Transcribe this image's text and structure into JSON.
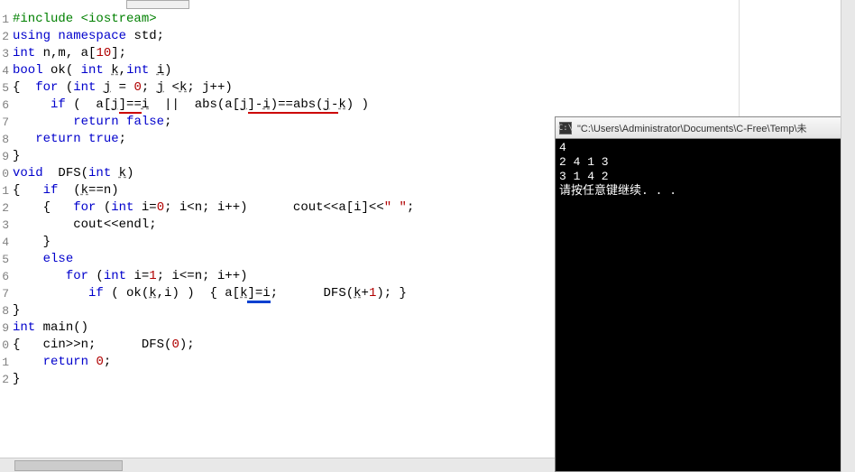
{
  "editor": {
    "lines": [
      {
        "n": "1",
        "tokens": [
          {
            "t": "#include <iostream>",
            "c": "green"
          }
        ]
      },
      {
        "n": "2",
        "tokens": [
          {
            "t": "using",
            "c": "blue"
          },
          {
            "t": " ",
            "c": "black"
          },
          {
            "t": "namespace",
            "c": "blue"
          },
          {
            "t": " std;",
            "c": "black"
          }
        ]
      },
      {
        "n": "3",
        "tokens": [
          {
            "t": "int",
            "c": "blue"
          },
          {
            "t": " n,m, a[",
            "c": "black"
          },
          {
            "t": "10",
            "c": "red"
          },
          {
            "t": "];",
            "c": "black"
          }
        ]
      },
      {
        "n": "4",
        "tokens": [
          {
            "t": "bool",
            "c": "blue"
          },
          {
            "t": " ok( ",
            "c": "black"
          },
          {
            "t": "int",
            "c": "blue"
          },
          {
            "t": " ",
            "c": "black"
          },
          {
            "t": "k",
            "c": "black",
            "d": true
          },
          {
            "t": ",",
            "c": "black"
          },
          {
            "t": "int",
            "c": "blue"
          },
          {
            "t": " ",
            "c": "black"
          },
          {
            "t": "i",
            "c": "black",
            "d": true
          },
          {
            "t": ")",
            "c": "black"
          }
        ]
      },
      {
        "n": "5",
        "tokens": [
          {
            "t": "{  ",
            "c": "black"
          },
          {
            "t": "for",
            "c": "blue"
          },
          {
            "t": " (",
            "c": "black"
          },
          {
            "t": "int",
            "c": "blue"
          },
          {
            "t": " ",
            "c": "black"
          },
          {
            "t": "j",
            "c": "black",
            "d": true
          },
          {
            "t": " = ",
            "c": "black"
          },
          {
            "t": "0",
            "c": "red"
          },
          {
            "t": "; ",
            "c": "black"
          },
          {
            "t": "j",
            "c": "black",
            "d": true
          },
          {
            "t": " <",
            "c": "black"
          },
          {
            "t": "k",
            "c": "black",
            "d": true
          },
          {
            "t": "; j++)",
            "c": "black"
          }
        ]
      },
      {
        "n": "6",
        "tokens": [
          {
            "t": "     ",
            "c": "black"
          },
          {
            "t": "if",
            "c": "blue"
          },
          {
            "t": " (  a[",
            "c": "black"
          },
          {
            "t": "j",
            "c": "black",
            "d": true
          },
          {
            "t": "]==",
            "c": "black",
            "ur": true
          },
          {
            "t": "i",
            "c": "black",
            "d": true
          },
          {
            "t": "  ||  abs(",
            "c": "black"
          },
          {
            "t": "a[",
            "c": "black"
          },
          {
            "t": "j",
            "c": "black",
            "d": true
          },
          {
            "t": "]-",
            "c": "black",
            "ur": true
          },
          {
            "t": "i",
            "c": "black",
            "d": true,
            "ur": true
          },
          {
            "t": ")==abs(",
            "c": "black",
            "ur": true
          },
          {
            "t": "j",
            "c": "black",
            "d": true,
            "ur": true
          },
          {
            "t": "-",
            "c": "black",
            "ur": true
          },
          {
            "t": "k",
            "c": "black",
            "d": true
          },
          {
            "t": ") )",
            "c": "black"
          }
        ]
      },
      {
        "n": "7",
        "tokens": [
          {
            "t": "        ",
            "c": "black"
          },
          {
            "t": "return",
            "c": "blue"
          },
          {
            "t": " ",
            "c": "black"
          },
          {
            "t": "false",
            "c": "blue"
          },
          {
            "t": ";",
            "c": "black"
          }
        ]
      },
      {
        "n": "8",
        "tokens": [
          {
            "t": "   ",
            "c": "black"
          },
          {
            "t": "return",
            "c": "blue"
          },
          {
            "t": " ",
            "c": "black"
          },
          {
            "t": "true",
            "c": "blue"
          },
          {
            "t": ";",
            "c": "black"
          }
        ]
      },
      {
        "n": "9",
        "tokens": [
          {
            "t": "}",
            "c": "black"
          }
        ]
      },
      {
        "n": "0",
        "tokens": [
          {
            "t": "void",
            "c": "blue"
          },
          {
            "t": "  DFS(",
            "c": "black"
          },
          {
            "t": "int",
            "c": "blue"
          },
          {
            "t": " ",
            "c": "black"
          },
          {
            "t": "k",
            "c": "black",
            "d": true
          },
          {
            "t": ")",
            "c": "black"
          }
        ]
      },
      {
        "n": "1",
        "tokens": [
          {
            "t": "{   ",
            "c": "black"
          },
          {
            "t": "if",
            "c": "blue"
          },
          {
            "t": "  (",
            "c": "black"
          },
          {
            "t": "k",
            "c": "black",
            "d": true
          },
          {
            "t": "==n)",
            "c": "black"
          }
        ]
      },
      {
        "n": "2",
        "tokens": [
          {
            "t": "    {   ",
            "c": "black"
          },
          {
            "t": "for",
            "c": "blue"
          },
          {
            "t": " (",
            "c": "black"
          },
          {
            "t": "int",
            "c": "blue"
          },
          {
            "t": " i=",
            "c": "black"
          },
          {
            "t": "0",
            "c": "red"
          },
          {
            "t": "; i<n; i++)      cout<<a[i]<<",
            "c": "black"
          },
          {
            "t": "\" \"",
            "c": "red"
          },
          {
            "t": ";",
            "c": "black"
          }
        ]
      },
      {
        "n": "3",
        "tokens": [
          {
            "t": "        cout<<endl;",
            "c": "black"
          }
        ]
      },
      {
        "n": "4",
        "tokens": [
          {
            "t": "    }",
            "c": "black"
          }
        ]
      },
      {
        "n": "5",
        "tokens": [
          {
            "t": "    ",
            "c": "black"
          },
          {
            "t": "else",
            "c": "blue"
          }
        ]
      },
      {
        "n": "6",
        "tokens": [
          {
            "t": "       ",
            "c": "black"
          },
          {
            "t": "for",
            "c": "blue"
          },
          {
            "t": " (",
            "c": "black"
          },
          {
            "t": "int",
            "c": "blue"
          },
          {
            "t": " i=",
            "c": "black"
          },
          {
            "t": "1",
            "c": "red"
          },
          {
            "t": "; i<=n; i++)",
            "c": "black"
          }
        ]
      },
      {
        "n": "7",
        "tokens": [
          {
            "t": "          ",
            "c": "black"
          },
          {
            "t": "if",
            "c": "blue"
          },
          {
            "t": " ( ok(",
            "c": "black"
          },
          {
            "t": "k",
            "c": "black",
            "d": true
          },
          {
            "t": ",i) )  { a[",
            "c": "black"
          },
          {
            "t": "k",
            "c": "black",
            "d": true
          },
          {
            "t": "]=i",
            "c": "black",
            "ub": true
          },
          {
            "t": ";      DFS(",
            "c": "black"
          },
          {
            "t": "k",
            "c": "black",
            "d": true
          },
          {
            "t": "+",
            "c": "black"
          },
          {
            "t": "1",
            "c": "red"
          },
          {
            "t": "); }",
            "c": "black"
          }
        ]
      },
      {
        "n": "8",
        "tokens": [
          {
            "t": "}",
            "c": "black"
          }
        ]
      },
      {
        "n": "9",
        "tokens": [
          {
            "t": "int",
            "c": "blue"
          },
          {
            "t": " main()",
            "c": "black"
          }
        ]
      },
      {
        "n": "0",
        "tokens": [
          {
            "t": "{   cin>>n;      DFS(",
            "c": "black"
          },
          {
            "t": "0",
            "c": "red"
          },
          {
            "t": ");",
            "c": "black"
          }
        ]
      },
      {
        "n": "1",
        "tokens": [
          {
            "t": "    ",
            "c": "black"
          },
          {
            "t": "return",
            "c": "blue"
          },
          {
            "t": " ",
            "c": "black"
          },
          {
            "t": "0",
            "c": "red"
          },
          {
            "t": ";",
            "c": "black"
          }
        ]
      },
      {
        "n": "2",
        "tokens": [
          {
            "t": "}",
            "c": "black"
          }
        ]
      }
    ]
  },
  "console": {
    "title": "\"C:\\Users\\Administrator\\Documents\\C-Free\\Temp\\未",
    "icon_text": "C:\\",
    "output": [
      "4",
      "2 4 1 3",
      "3 1 4 2",
      "请按任意键继续. . ."
    ]
  }
}
